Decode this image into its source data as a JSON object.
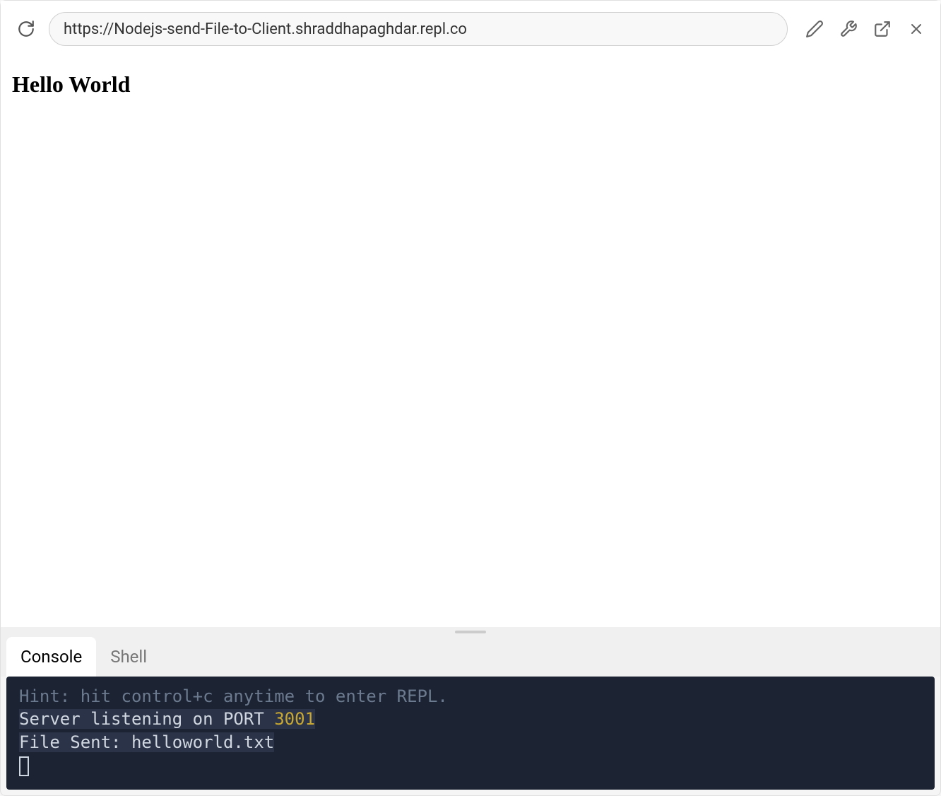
{
  "browser": {
    "url": "https://Nodejs-send-File-to-Client.shraddhapaghdar.repl.co"
  },
  "page": {
    "heading": "Hello World"
  },
  "tabs": {
    "console": "Console",
    "shell": "Shell",
    "active": "console"
  },
  "console": {
    "hint": "Hint: hit control+c anytime to enter REPL.",
    "line1_prefix": "Server listening on PORT ",
    "line1_port": "3001",
    "line2": "File Sent: helloworld.txt"
  }
}
